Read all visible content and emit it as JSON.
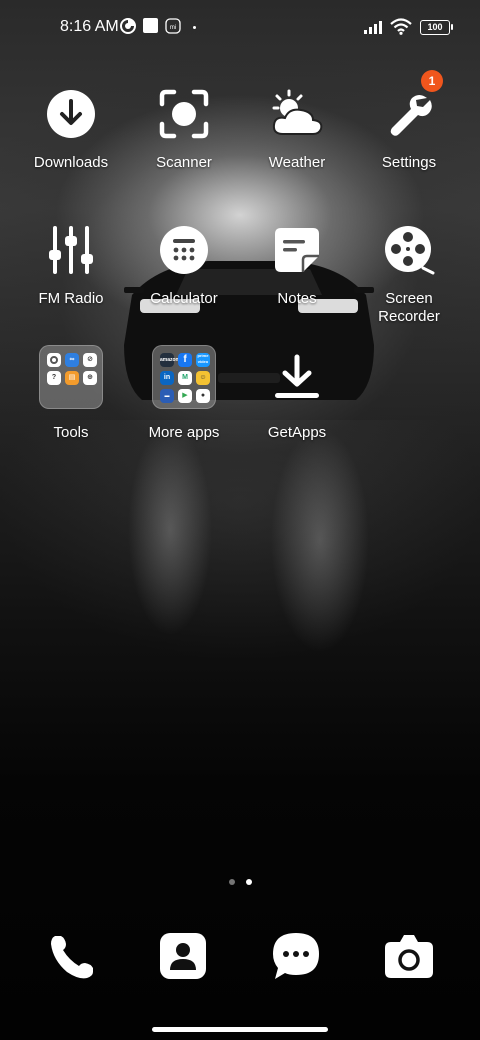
{
  "status_bar": {
    "time": "8:16 AM",
    "battery": "100",
    "icons": [
      "pie-chart-icon",
      "white-square-icon",
      "mi-icon",
      "dot-icon",
      "signal-icon",
      "wifi-icon",
      "battery-icon"
    ]
  },
  "apps": [
    {
      "label": "Downloads",
      "icon": "download-icon"
    },
    {
      "label": "Scanner",
      "icon": "scanner-icon"
    },
    {
      "label": "Weather",
      "icon": "weather-icon"
    },
    {
      "label": "Settings",
      "icon": "wrench-icon",
      "badge": "1"
    },
    {
      "label": "FM Radio",
      "icon": "equalizer-icon"
    },
    {
      "label": "Calculator",
      "icon": "calculator-icon"
    },
    {
      "label": "Notes",
      "icon": "notes-icon"
    },
    {
      "label": "Screen Recorder",
      "icon": "film-reel-icon"
    },
    {
      "label": "Tools",
      "icon": "folder-icon"
    },
    {
      "label": "More apps",
      "icon": "folder-icon"
    },
    {
      "label": "GetApps",
      "icon": "download-tray-icon"
    }
  ],
  "folders": {
    "more_apps_minis": [
      "amazon",
      "f",
      "prime video",
      "in",
      "",
      "",
      "",
      "",
      ""
    ]
  },
  "dock": [
    {
      "icon": "phone-icon"
    },
    {
      "icon": "contacts-icon"
    },
    {
      "icon": "messages-icon"
    },
    {
      "icon": "camera-icon"
    }
  ],
  "pages": {
    "count": 2,
    "active": 2
  },
  "colors": {
    "badge": "#f0561d",
    "text": "#ffffff"
  }
}
